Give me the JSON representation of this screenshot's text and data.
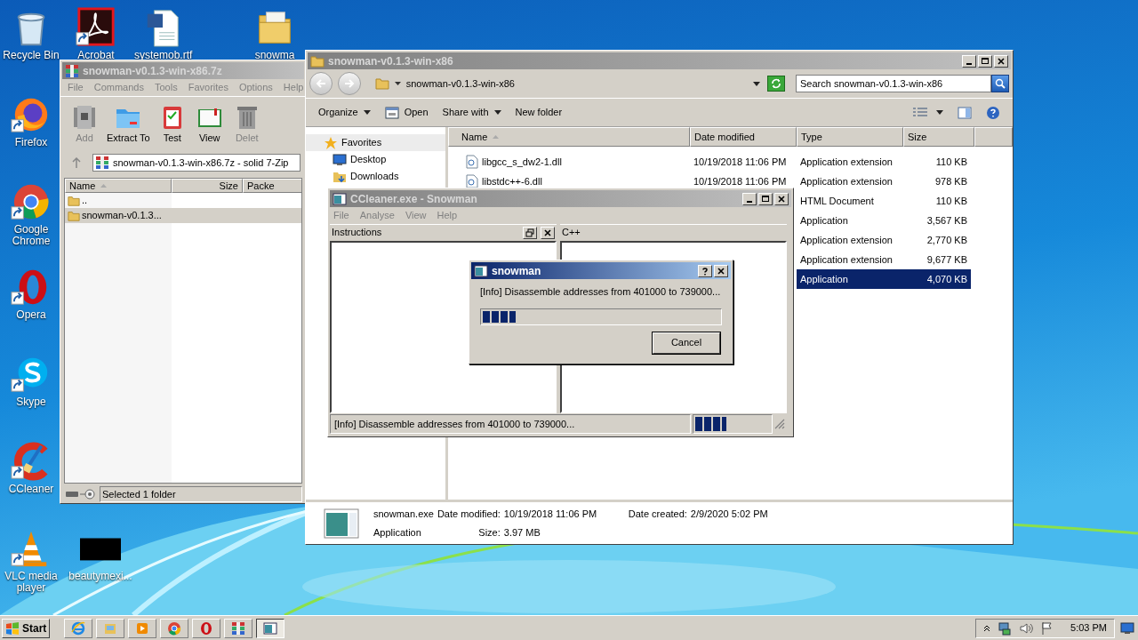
{
  "desktop_icons": [
    {
      "label": "Recycle Bin",
      "kind": "recycle",
      "shortcut": false
    },
    {
      "label": "Acrobat",
      "kind": "acrobat",
      "shortcut": true
    },
    {
      "label": "systemob.rtf",
      "kind": "word",
      "shortcut": false
    },
    {
      "label": "snowma",
      "kind": "folder",
      "shortcut": false
    },
    {
      "label": "Firefox",
      "kind": "firefox",
      "shortcut": true
    },
    {
      "label": "Google Chrome",
      "kind": "chrome",
      "shortcut": true
    },
    {
      "label": "Opera",
      "kind": "opera",
      "shortcut": true
    },
    {
      "label": "Skype",
      "kind": "skype",
      "shortcut": true
    },
    {
      "label": "CCleaner",
      "kind": "ccleaner",
      "shortcut": true
    },
    {
      "label": "VLC media player",
      "kind": "vlc",
      "shortcut": true
    },
    {
      "label": "beautymexi...",
      "kind": "dark",
      "shortcut": false
    }
  ],
  "archive_window": {
    "title": "snowman-v0.1.3-win-x86.7z",
    "menu": [
      "File",
      "Commands",
      "Tools",
      "Favorites",
      "Options",
      "Help"
    ],
    "toolbar": [
      {
        "label": "Add",
        "kind": "add",
        "disabled": true
      },
      {
        "label": "Extract To",
        "kind": "extract",
        "disabled": false
      },
      {
        "label": "Test",
        "kind": "test",
        "disabled": false
      },
      {
        "label": "View",
        "kind": "view",
        "disabled": false
      },
      {
        "label": "Delet",
        "kind": "delete",
        "disabled": true
      }
    ],
    "path": "snowman-v0.1.3-win-x86.7z - solid 7-Zip",
    "columns": [
      "Name",
      "Size",
      "Packe"
    ],
    "rows": [
      {
        "name": "..",
        "selected": false
      },
      {
        "name": "snowman-v0.1.3...",
        "selected": true
      }
    ],
    "status": "Selected 1 folder"
  },
  "explorer_window": {
    "title": "snowman-v0.1.3-win-x86",
    "breadcrumb": "snowman-v0.1.3-win-x86",
    "search_placeholder": "Search snowman-v0.1.3-win-x86",
    "toolbar": [
      {
        "label": "Organize",
        "kind": "menu"
      },
      {
        "label": "Open",
        "kind": "open"
      },
      {
        "label": "Share with",
        "kind": "menu"
      },
      {
        "label": "New folder",
        "kind": "plain"
      }
    ],
    "nav": [
      {
        "label": "Favorites",
        "kind": "star",
        "selected": true
      },
      {
        "label": "Desktop",
        "kind": "desktop",
        "selected": false
      },
      {
        "label": "Downloads",
        "kind": "downloads",
        "selected": false
      }
    ],
    "columns": [
      "Name",
      "Date modified",
      "Type",
      "Size"
    ],
    "rows": [
      {
        "name": "libgcc_s_dw2-1.dll",
        "date": "10/19/2018 11:06 PM",
        "type": "Application extension",
        "size": "110 KB",
        "selected": false
      },
      {
        "name": "libstdc++-6.dll",
        "date": "10/19/2018 11:06 PM",
        "type": "Application extension",
        "size": "978 KB",
        "selected": false
      },
      {
        "type": "HTML Document",
        "size": "110 KB",
        "selected": false
      },
      {
        "type": "Application",
        "size": "3,567 KB",
        "selected": false
      },
      {
        "type": "Application extension",
        "size": "2,770 KB",
        "selected": false
      },
      {
        "type": "Application extension",
        "size": "9,677 KB",
        "selected": false
      },
      {
        "type": "Application",
        "size": "4,070 KB",
        "selected": true
      }
    ],
    "details": {
      "name": "snowman.exe",
      "type": "Application",
      "date_modified_label": "Date modified:",
      "date_modified": "10/19/2018 11:06 PM",
      "date_created_label": "Date created:",
      "date_created": "2/9/2020 5:02 PM",
      "size_label": "Size:",
      "size": "3.97 MB"
    }
  },
  "snowman_window": {
    "title": "CCleaner.exe - Snowman",
    "menu": [
      "File",
      "Analyse",
      "View",
      "Help"
    ],
    "panes": [
      "Instructions",
      "C++"
    ],
    "status": "[Info] Disassemble addresses from 401000 to 739000...",
    "status_progress": {
      "level": 0.42
    }
  },
  "dialog": {
    "title": "snowman",
    "message": "[Info] Disassemble addresses from 401000 to 739000...",
    "progress": {
      "level": 0.14
    },
    "button": "Cancel"
  },
  "taskbar": {
    "start": "Start",
    "apps": [
      {
        "kind": "ie",
        "selected": false
      },
      {
        "kind": "explorer",
        "selected": false
      },
      {
        "kind": "media",
        "selected": false
      },
      {
        "kind": "chrome",
        "selected": false
      },
      {
        "kind": "opera",
        "selected": false
      },
      {
        "kind": "winrar",
        "selected": false
      },
      {
        "kind": "snowman",
        "selected": true
      }
    ],
    "time": "5:03 PM"
  }
}
